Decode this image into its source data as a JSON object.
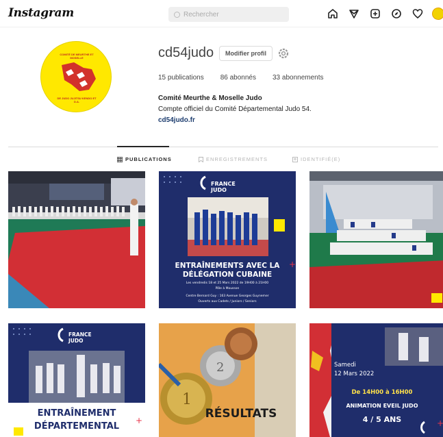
{
  "header": {
    "logo": "Instagram",
    "search_placeholder": "Rechercher"
  },
  "profile": {
    "username": "cd54judo",
    "edit_label": "Modifier profil",
    "stats": {
      "publications": "15 publications",
      "abonnes": "86 abonnés",
      "abonnements": "33 abonnements"
    },
    "bio_name": "Comité Meurthe & Moselle Judo",
    "bio_text": "Compte officiel du Comité Départemental Judo 54.",
    "bio_link": "cd54judo.fr",
    "avatar_top": "COMITÉ DE MEURTHE ET MOSELLE",
    "avatar_bottom": "DE JUDO JUJITSU KENDO ET D.A."
  },
  "tabs": [
    {
      "label": "PUBLICATIONS",
      "active": true
    },
    {
      "label": "ENREGISTREMENTS",
      "active": false
    },
    {
      "label": "IDENTIFIÉ(E)",
      "active": false
    }
  ],
  "posts": {
    "p2": {
      "brand": "FRANCE JUDO",
      "title1": "ENTRAÎNEMENTS AVEC LA",
      "title2": "DÉLÉGATION CUBAINE",
      "line1": "Les vendredis 18 et 25 Mars 2022 de 19H00 à 21H00",
      "line2": "Pôle à Mousson",
      "line3": "Centre Bernard Guy : 163 Avenue Georges Guynemer",
      "line4": "Ouverts aux Cadets / Juniors / Seniors"
    },
    "p4": {
      "brand": "FRANCE JUDO",
      "title1": "ENTRAÎNEMENT",
      "title2": "DÉPARTEMENTAL"
    },
    "p5": {
      "title": "RÉSULTATS"
    },
    "p6": {
      "line1": "Samedi",
      "line2": "12 Mars 2022",
      "line3": "De 14H00 à 16H00",
      "line4": "ANIMATION EVEIL JUDO",
      "line5": "4 / 5 ANS"
    }
  },
  "colors": {
    "accent_yellow": "#ffe800",
    "post_blue": "#1f2d6b",
    "mat_red": "#d22f35",
    "mat_green": "#1f7a56"
  }
}
